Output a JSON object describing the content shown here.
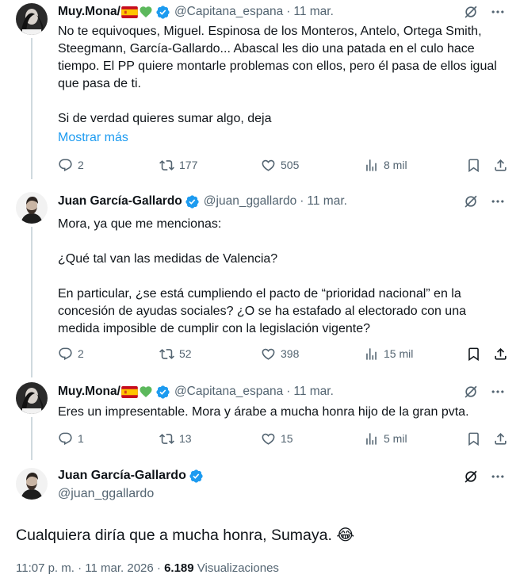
{
  "tweets": [
    {
      "name": "Muy.Mona/",
      "handle": "@Capitana_espana",
      "date": "11 mar.",
      "paragraphs": [
        "No te equivoques, Miguel. Espinosa de los Monteros, Antelo, Ortega Smith, Steegmann, García-Gallardo... Abascal les dio una patada en el culo hace tiempo. El PP quiere montarle problemas con ellos, pero él pasa de ellos igual que pasa de ti.",
        "Si de verdad quieres sumar algo, deja"
      ],
      "show_more": "Mostrar más",
      "replies": "2",
      "retweets": "177",
      "likes": "505",
      "views": "8 mil"
    },
    {
      "name": "Juan García-Gallardo",
      "handle": "@juan_ggallardo",
      "date": "11 mar.",
      "paragraphs": [
        "Mora, ya que me mencionas:",
        "¿Qué tal van las medidas de Valencia?",
        "En particular, ¿se está cumpliendo el pacto de “prioridad nacional” en la concesión de ayudas sociales? ¿O se ha estafado al electorado con una medida imposible de cumplir con la legislación vigente?"
      ],
      "replies": "2",
      "retweets": "52",
      "likes": "398",
      "views": "15 mil"
    },
    {
      "name": "Muy.Mona/",
      "handle": "@Capitana_espana",
      "date": "11 mar.",
      "paragraphs": [
        "Eres un impresentable. Mora y árabe a mucha honra hijo de la gran pvta."
      ],
      "replies": "1",
      "retweets": "13",
      "likes": "15",
      "views": "5 mil"
    }
  ],
  "main_tweet": {
    "name": "Juan García-Gallardo",
    "handle": "@juan_ggallardo",
    "text": "Cualquiera diría que a mucha honra, Sumaya. 😂",
    "time": "11:07 p. m.",
    "date": "11 mar. 2026",
    "views_count": "6.189",
    "views_label": "Visualizaciones"
  },
  "colors": {
    "text": "#0f1419",
    "secondary": "#536471",
    "link": "#1d9bf0",
    "verified": "#1d9bf0",
    "divider": "#eff3f4"
  },
  "icons": [
    "grok-icon",
    "more-icon",
    "reply-icon",
    "retweet-icon",
    "like-icon",
    "views-icon",
    "bookmark-icon",
    "share-icon",
    "spain-flag-icon",
    "green-heart-icon",
    "verified-badge-icon"
  ]
}
